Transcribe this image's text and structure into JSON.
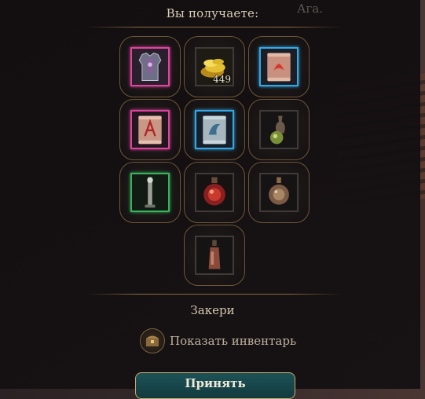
{
  "header": {
    "title": "Вы получаете:",
    "background_text": "Ага."
  },
  "items": [
    {
      "icon": "armor-icon",
      "rarity": "pink",
      "count": ""
    },
    {
      "icon": "gold-coins-icon",
      "rarity": "none",
      "count": "449"
    },
    {
      "icon": "scroll-red-icon",
      "rarity": "blue",
      "count": ""
    },
    {
      "icon": "scroll-rune-icon",
      "rarity": "pink",
      "count": ""
    },
    {
      "icon": "scroll-blue-icon",
      "rarity": "blue",
      "count": ""
    },
    {
      "icon": "green-potion-icon",
      "rarity": "none",
      "count": ""
    },
    {
      "icon": "staff-icon",
      "rarity": "green",
      "count": ""
    },
    {
      "icon": "red-potion-icon",
      "rarity": "none",
      "count": ""
    },
    {
      "icon": "round-flask-icon",
      "rarity": "none",
      "count": ""
    },
    {
      "icon": "bottle-icon",
      "rarity": "none",
      "count": ""
    }
  ],
  "container": {
    "name": "Закери"
  },
  "inventory": {
    "label": "Показать инвентарь",
    "icon": "chest-icon"
  },
  "footer": {
    "accept_label": "Принять"
  },
  "colors": {
    "rare_pink": "#e0449e",
    "rare_blue": "#33a8e6",
    "uncommon_green": "#38b25c",
    "accent_gold": "#c8a96a"
  }
}
